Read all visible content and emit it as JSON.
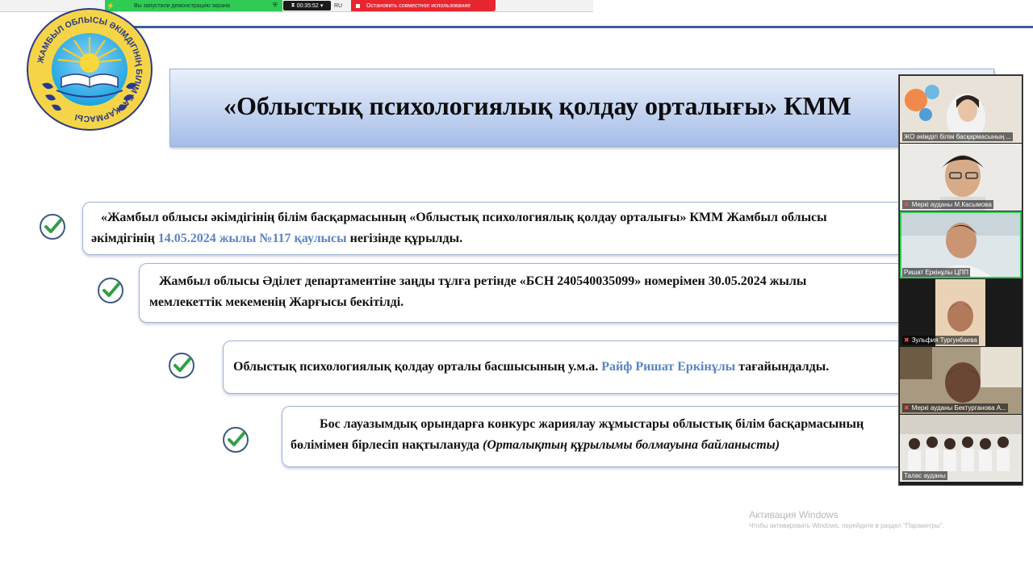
{
  "zoom_bar": {
    "sharing_text": "Вы запустили демонстрацию экрана",
    "timer": "00:35:52",
    "language": "RU",
    "stop_label": "Остановить совместное использование"
  },
  "slide": {
    "logo_text": "ЖАМБЫЛ ОБЛЫСЫ ӘКІМДІГІНІҢ БІЛІМ БАСҚАРМАСЫ",
    "title": "«Облыстық психологиялық қолдау орталығы» КММ",
    "cards": [
      {
        "line1": "«Жамбыл облысы әкімдігінің білім басқармасының «Облыстық психологиялық қолдау орталығы» КММ Жамбыл облысы",
        "line2_pre": "әкімдігінің ",
        "line2_hl": "14.05.2024 жылы №117 қаулысы",
        "line2_post": " негізінде құрылды."
      },
      {
        "line1": "Жамбыл облысы Әділет департаментіне заңды тұлға ретінде «БСН 240540035099» номерімен  30.05.2024 жылы",
        "line2": "мемлекеттік мекеменің Жарғысы бекітілді."
      },
      {
        "line1_pre": "Облыстық психологиялық қолдау орталы басшысының у.м.а. ",
        "line1_hl": "Райф Ришат Еркінұлы",
        "line1_post": " тағайындалды."
      },
      {
        "line1": "Бос лауазымдық орындарға конкурс жариялау жұмыстары облыстық білім басқармасының",
        "line2_pre": "бөлімімен  бірлесіп нақтылануда ",
        "line2_it": "(Орталықтың құрылымы болмауына байланысты)"
      }
    ]
  },
  "participants": [
    {
      "name": "ЖО әкімдігі білім басқармасының ...",
      "muted": false
    },
    {
      "name": "Меркі ауданы  М.Касымова",
      "muted": true
    },
    {
      "name": "Ришат Еркінұлы ЦПП",
      "muted": false
    },
    {
      "name": "Зульфия Тургунбаева",
      "muted": true
    },
    {
      "name": "Меркі ауданы Бектурганова А...",
      "muted": true
    },
    {
      "name": "Талас ауданы",
      "muted": false
    }
  ],
  "watermark": {
    "title": "Активация Windows",
    "subtitle": "Чтобы активировать Windows, перейдите в раздел \"Параметры\"."
  },
  "colors": {
    "accent_blue": "#5a84c4",
    "zoom_green": "#2fcb55",
    "zoom_red": "#e8262f",
    "check_green": "#2ea043"
  }
}
